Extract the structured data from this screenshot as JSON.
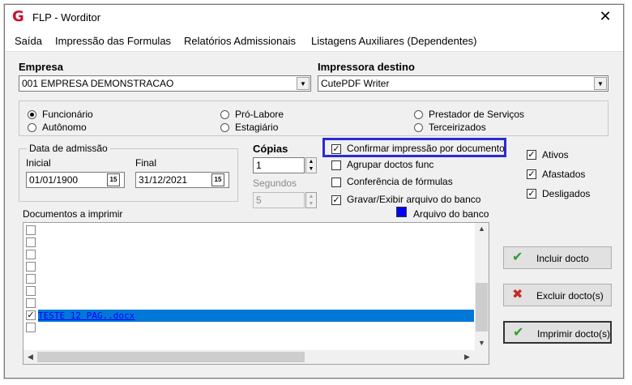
{
  "window": {
    "title": "FLP - Worditor",
    "close_glyph": "✕",
    "logo_glyph": "G"
  },
  "menu": [
    {
      "label": "Saída"
    },
    {
      "label": "Impressão das Formulas"
    },
    {
      "label": "Relatórios Admissionais"
    },
    {
      "label": "Listagens Auxiliares (Dependentes)"
    }
  ],
  "empresa": {
    "label": "Empresa",
    "value": "001 EMPRESA DEMONSTRACAO"
  },
  "impressora": {
    "label": "Impressora destino",
    "value": "CutePDF Writer"
  },
  "tipo_radios": [
    {
      "label": "Funcionário",
      "checked": true
    },
    {
      "label": "Autônomo",
      "checked": false
    },
    {
      "label": "Pró-Labore",
      "checked": false
    },
    {
      "label": "Estagiário",
      "checked": false
    },
    {
      "label": "Prestador de Serviços",
      "checked": false
    },
    {
      "label": "Terceirizados",
      "checked": false
    }
  ],
  "admissao": {
    "group_label": "Data de admissão",
    "inicial_label": "Inicial",
    "inicial_value": "01/01/1900",
    "final_label": "Final",
    "final_value": "31/12/2021",
    "cal_glyph": "15"
  },
  "copias": {
    "label": "Cópias",
    "value": "1"
  },
  "segundos": {
    "label": "Segundos",
    "value": "5"
  },
  "options": [
    {
      "label": "Confirmar impressão por documento",
      "checked": true
    },
    {
      "label": "Agrupar doctos func",
      "checked": false
    },
    {
      "label": "Conferência de fórmulas",
      "checked": false
    },
    {
      "label": "Gravar/Exibir arquivo do banco",
      "checked": true
    }
  ],
  "status_checks": [
    {
      "label": "Ativos",
      "checked": true
    },
    {
      "label": "Afastados",
      "checked": true
    },
    {
      "label": "Desligados",
      "checked": true
    }
  ],
  "arquivo_banco": {
    "label": "Arquivo do banco",
    "color": "#0000ff"
  },
  "documentos": {
    "label": "Documentos a imprimir",
    "rows": [
      {
        "checked": false,
        "text": ""
      },
      {
        "checked": false,
        "text": ""
      },
      {
        "checked": false,
        "text": ""
      },
      {
        "checked": false,
        "text": ""
      },
      {
        "checked": false,
        "text": ""
      },
      {
        "checked": false,
        "text": ""
      },
      {
        "checked": false,
        "text": ""
      },
      {
        "checked": true,
        "text": "TESTE 12 PAG..docx",
        "selected": true
      },
      {
        "checked": false,
        "text": ""
      }
    ]
  },
  "buttons": {
    "incluir": {
      "label": "Incluir docto",
      "icon": "check-icon"
    },
    "excluir": {
      "label": "Excluir docto(s)",
      "icon": "x-icon"
    },
    "imprimir": {
      "label": "Imprimir docto(s)",
      "icon": "check-icon"
    }
  },
  "colors": {
    "accent_highlight": "#2b2bd6",
    "selection": "#0078d7",
    "logo": "#c8102e"
  }
}
